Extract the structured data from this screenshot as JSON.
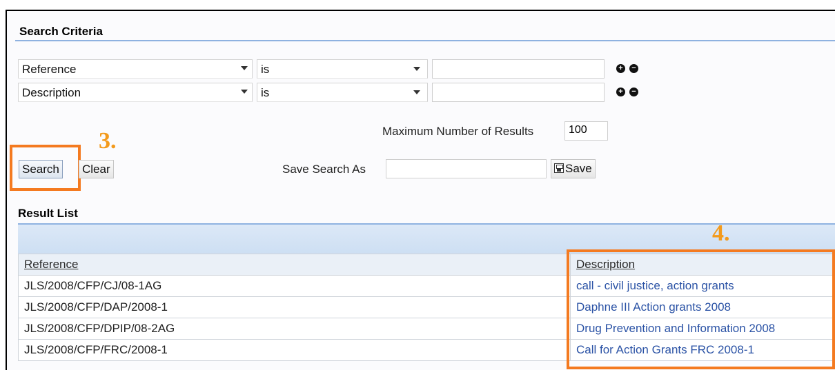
{
  "search_criteria": {
    "title": "Search Criteria",
    "rows": [
      {
        "field": "Reference",
        "operator": "is",
        "value": ""
      },
      {
        "field": "Description",
        "operator": "is",
        "value": ""
      }
    ],
    "add_symbol": "+",
    "remove_symbol": "−",
    "max_results_label": "Maximum Number of Results",
    "max_results_value": "100",
    "save_search_label": "Save Search As",
    "save_search_value": "",
    "save_button_label": "Save",
    "search_button_label": "Search",
    "clear_button_label": "Clear"
  },
  "callouts": {
    "step3": "3.",
    "step4": "4."
  },
  "result_list": {
    "title": "Result List",
    "columns": [
      "Reference",
      "Description"
    ],
    "rows": [
      {
        "reference": "JLS/2008/CFP/CJ/08-1AG",
        "description": "call - civil justice, action grants"
      },
      {
        "reference": "JLS/2008/CFP/DAP/2008-1",
        "description": "Daphne III Action grants 2008"
      },
      {
        "reference": "JLS/2008/CFP/DPIP/08-2AG",
        "description": "Drug Prevention and Information 2008"
      },
      {
        "reference": "JLS/2008/CFP/FRC/2008-1",
        "description": "Call for Action Grants FRC 2008-1"
      }
    ]
  },
  "colors": {
    "highlight": "#f47a20",
    "callout_text": "#f39a1c",
    "link": "#2a52a5",
    "accent_line": "#8fb2e0"
  }
}
